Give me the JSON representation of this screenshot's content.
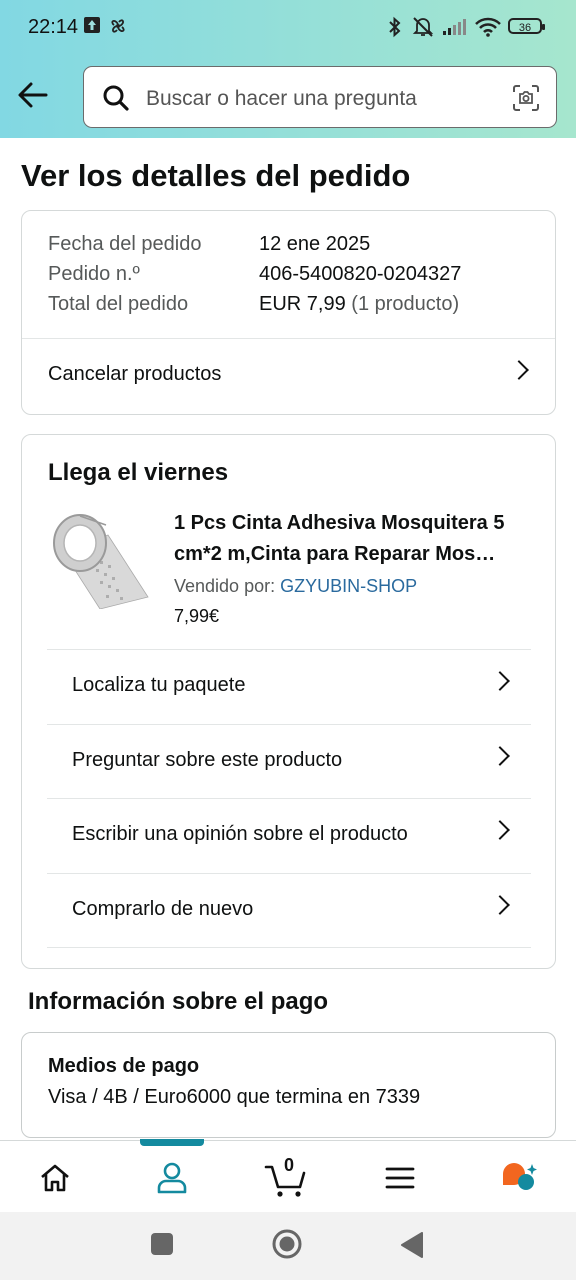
{
  "status_bar": {
    "time": "22:14",
    "battery": "36"
  },
  "search": {
    "placeholder": "Buscar o hacer una pregunta"
  },
  "page": {
    "title": "Ver los detalles del pedido"
  },
  "order": {
    "date_label": "Fecha del pedido",
    "date_value": "12 ene 2025",
    "number_label": "Pedido n.º",
    "number_value": "406-5400820-0204327",
    "total_label": "Total del pedido",
    "total_value": "EUR 7,99",
    "total_count": "(1 producto)",
    "cancel_label": "Cancelar productos"
  },
  "shipment": {
    "arrival": "Llega el viernes",
    "product_title": "1 Pcs Cinta Adhesiva Mosquitera 5 cm*2 m,Cinta para Reparar Mos…",
    "seller_label": "Vendido por:",
    "seller_name": "GZYUBIN-SHOP",
    "price": "7,99€",
    "actions": [
      "Localiza tu paquete",
      "Preguntar sobre este producto",
      "Escribir una opinión sobre el producto",
      "Comprarlo de nuevo"
    ]
  },
  "payment": {
    "section_title": "Información sobre el pago",
    "methods_label": "Medios de pago",
    "methods_value": "Visa / 4B / Euro6000  que termina en 7339"
  },
  "bottom_nav": {
    "cart_count": "0"
  },
  "colors": {
    "header_start": "#82d8e3",
    "header_end": "#a6e6ce",
    "accent": "#148a9f",
    "link": "#2a6a9e"
  }
}
